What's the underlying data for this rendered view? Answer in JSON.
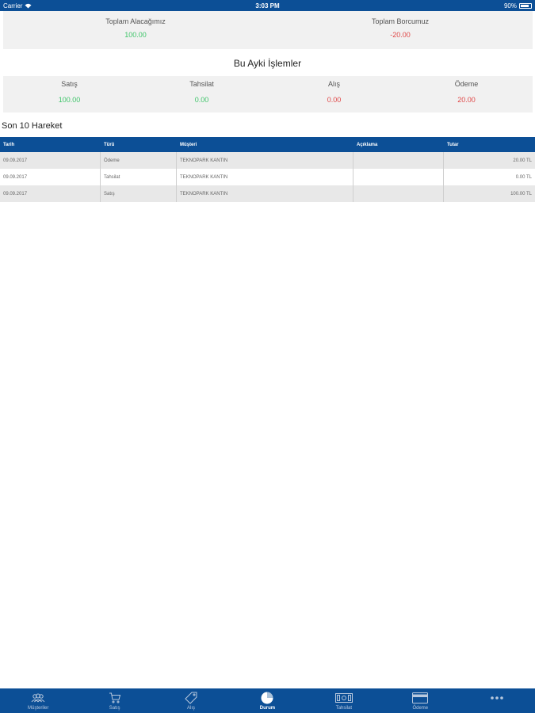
{
  "status_bar": {
    "carrier": "Carrier",
    "time": "3:03 PM",
    "battery": "90%"
  },
  "summary": {
    "receivable_label": "Toplam Alacağımız",
    "receivable_value": "100.00",
    "payable_label": "Toplam Borcumuz",
    "payable_value": "-20.00"
  },
  "monthly_title": "Bu Ayki İşlemler",
  "monthly": {
    "items": [
      {
        "label": "Satış",
        "value": "100.00",
        "color": "#3fc56a"
      },
      {
        "label": "Tahsilat",
        "value": "0.00",
        "color": "#3fc56a"
      },
      {
        "label": "Alış",
        "value": "0.00",
        "color": "#e04848"
      },
      {
        "label": "Ödeme",
        "value": "20.00",
        "color": "#e04848"
      }
    ]
  },
  "last_title": "Son 10 Hareket",
  "table": {
    "headers": [
      "Tarih",
      "Türü",
      "Müşteri",
      "Açıklama",
      "Tutar"
    ],
    "rows": [
      [
        "09.09.2017",
        "Ödeme",
        "TEKNOPARK KANTIN",
        "",
        "20.00 TL"
      ],
      [
        "09.09.2017",
        "Tahsilat",
        "TEKNOPARK KANTIN",
        "",
        "0.00 TL"
      ],
      [
        "09.09.2017",
        "Satış",
        "TEKNOPARK KANTIN",
        "",
        "100.00 TL"
      ]
    ]
  },
  "tabbar": {
    "items": [
      {
        "label": "Müşteriler",
        "icon": "customers-icon"
      },
      {
        "label": "Satış",
        "icon": "cart-icon"
      },
      {
        "label": "Alış",
        "icon": "tag-icon"
      },
      {
        "label": "Durum",
        "icon": "pie-chart-icon",
        "active": true
      },
      {
        "label": "Tahsilat",
        "icon": "cash-icon"
      },
      {
        "label": "Ödeme",
        "icon": "credit-card-icon"
      },
      {
        "label": "",
        "icon": "more-icon"
      }
    ]
  },
  "colors": {
    "brand": "#0c4f96",
    "positive": "#3fc56a",
    "negative": "#e04848"
  }
}
